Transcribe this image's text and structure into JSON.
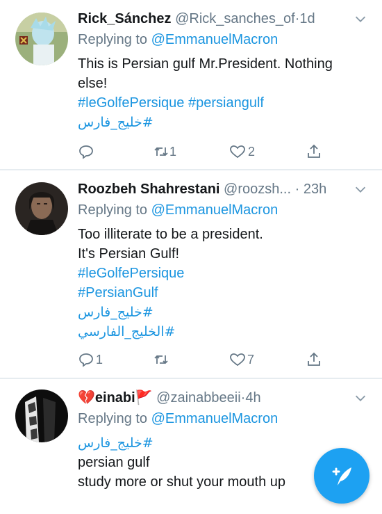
{
  "tweets": [
    {
      "name": "Rick_Sánchez",
      "handle": "@Rick_sanches_of",
      "dot": "·",
      "time": "1d",
      "replying_prefix": "Replying to ",
      "replying_to": "@EmmanuelMacron",
      "text_lines": [
        "This is Persian gulf Mr.President. Nothing",
        "else!"
      ],
      "hashtag_lines": [
        "#leGolfePersique #persiangulf",
        "#خلیج_فارس"
      ],
      "reply_count": "",
      "retweet_count": "1",
      "like_count": "2"
    },
    {
      "name": "Roozbeh Shahrestani",
      "handle": "@roozsh...",
      "dot": "·",
      "time": "23h",
      "replying_prefix": "Replying to ",
      "replying_to": "@EmmanuelMacron",
      "text_lines": [
        "Too illiterate to be a president.",
        "It's Persian Gulf!"
      ],
      "hashtag_lines": [
        "#leGolfePersique",
        "#PersianGulf",
        "#خلیج_فارس",
        "#الخليج_الفارسي"
      ],
      "reply_count": "1",
      "retweet_count": "",
      "like_count": "7"
    },
    {
      "name_prefix_emoji": "💔",
      "name": "einabi",
      "name_suffix_emoji": "🚩",
      "handle": "@zainabbeeii",
      "dot": "·",
      "time": "4h",
      "replying_prefix": "Replying to ",
      "replying_to": "@EmmanuelMacron",
      "hashtag_lines": [
        "#خلیج_فارس"
      ],
      "text_lines": [
        "persian gulf",
        "study more or shut your mouth up"
      ]
    }
  ],
  "icons": {
    "reply": "reply-icon",
    "retweet": "retweet-icon",
    "like": "heart-icon",
    "share": "share-icon",
    "more": "chevron-down-icon",
    "compose": "compose-tweet-icon"
  },
  "colors": {
    "accent": "#1da1f2",
    "link": "#1b95e0",
    "secondary_text": "#657786",
    "separator": "#e6ecf0"
  }
}
